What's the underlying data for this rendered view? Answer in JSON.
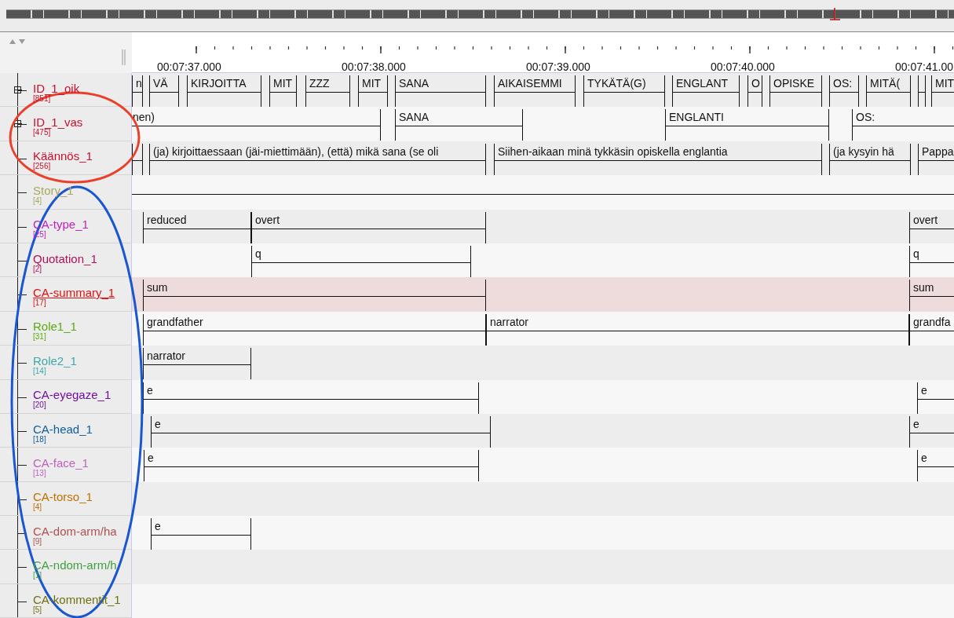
{
  "ruler": {
    "labels": [
      "00:07:37.000",
      "00:07:38.000",
      "00:07:39.000",
      "00:07:40.000",
      "00:07:41.00"
    ]
  },
  "tiers": [
    {
      "name": "ID_1_oik",
      "count": "[851]",
      "color": "#c8102e",
      "selected": false,
      "expanded": false,
      "annotations": [
        "n",
        "VÄ",
        "KIRJOITTA",
        "MIT",
        "ZZZ",
        "MIT",
        "SANA",
        "AIKAISEMMI",
        "TYKÄTÄ(G)",
        "ENGLANT",
        "O",
        "OPISKE",
        "OS:",
        "MITÄ(",
        "MIT"
      ]
    },
    {
      "name": "ID_1_vas",
      "count": "[475]",
      "color": "#c8102e",
      "selected": false,
      "expanded": false,
      "annotations": [
        "nen)",
        "SANA",
        "ENGLANTI",
        "OS:"
      ]
    },
    {
      "name": "Käännös_1",
      "count": "[256]",
      "color": "#c8102e",
      "selected": false,
      "annotations": [
        "(ja) kirjoittaessaan (jäi-miettimään), (että) mikä sana (se oli",
        "Siihen-aikaan minä tykkäsin opiskella englantia",
        "(ja kysyin hä",
        "Pappa"
      ]
    },
    {
      "name": "Story_1",
      "count": "[4]",
      "color": "#a8a860",
      "selected": false
    },
    {
      "name": "CA-type_1",
      "count": "[25]",
      "color": "#c020c0",
      "selected": false,
      "annotations": [
        "reduced",
        "overt",
        "overt"
      ]
    },
    {
      "name": "Quotation_1",
      "count": "[2]",
      "color": "#b0105a",
      "selected": false,
      "annotations": [
        "q",
        "q"
      ]
    },
    {
      "name": "CA-summary_1",
      "count": "[17]",
      "color": "#e01010",
      "selected": true,
      "annotations": [
        "sum",
        "sum"
      ]
    },
    {
      "name": "Role1_1",
      "count": "[31]",
      "color": "#5aaa10",
      "selected": false,
      "annotations": [
        "grandfather",
        "narrator",
        "grandfa"
      ]
    },
    {
      "name": "Role2_1",
      "count": "[14]",
      "color": "#40a8a8",
      "selected": false,
      "annotations": [
        "narrator"
      ]
    },
    {
      "name": "CA-eyegaze_1",
      "count": "[20]",
      "color": "#7010a0",
      "selected": false,
      "annotations": [
        "e",
        "e"
      ]
    },
    {
      "name": "CA-head_1",
      "count": "[18]",
      "color": "#1060a0",
      "selected": false,
      "annotations": [
        "e",
        "e"
      ]
    },
    {
      "name": "CA-face_1",
      "count": "[13]",
      "color": "#c060c0",
      "selected": false,
      "annotations": [
        "e",
        "e"
      ]
    },
    {
      "name": "CA-torso_1",
      "count": "[4]",
      "color": "#c07000",
      "selected": false
    },
    {
      "name": "CA-dom-arm/ha",
      "count": "[9]",
      "color": "#b05050",
      "selected": false,
      "annotations": [
        "e"
      ]
    },
    {
      "name": "CA-ndom-arm/h",
      "count": "[1]",
      "color": "#40a040",
      "selected": false
    },
    {
      "name": "CA-kommentit_1",
      "count": "[5]",
      "color": "#707010",
      "selected": false
    }
  ]
}
